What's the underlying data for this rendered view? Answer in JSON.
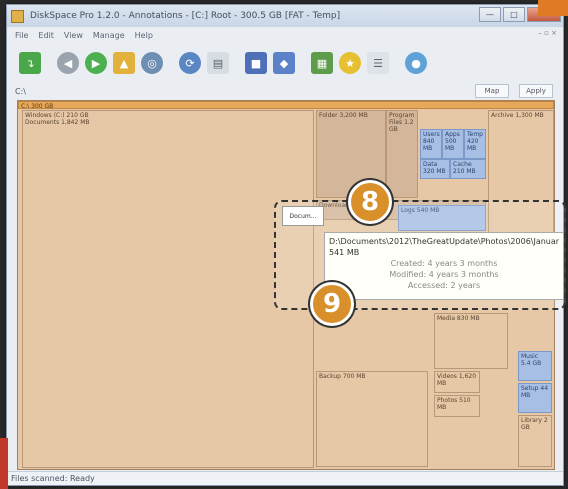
{
  "window": {
    "title": "DiskSpace Pro 1.2.0 - Annotations - [C:] Root - 300.5 GB [FAT - Temp]",
    "min": "—",
    "max": "□",
    "close": "✕"
  },
  "menu": [
    "File",
    "Edit",
    "View",
    "Manage",
    "Help"
  ],
  "mdi": "– ▫ ×",
  "path": {
    "text": "C:\\",
    "btn1": "Map",
    "btn2": "Apply"
  },
  "treemap": {
    "root_label": "C:\\ 300 GB",
    "items": [
      {
        "label": "Windows (C:) 210 GB\nDocuments 1,842 MB"
      },
      {
        "label": "Folder 3,200 MB"
      },
      {
        "label": "Program Files 1.2 GB"
      },
      {
        "label": "Users 840 MB"
      },
      {
        "label": "Apps 500 MB"
      },
      {
        "label": "Temp 420 MB"
      },
      {
        "label": "Data 320 MB"
      },
      {
        "label": "Cache 210 MB"
      },
      {
        "label": "Archive 1,300 MB"
      },
      {
        "label": "Downloads 640 MB"
      },
      {
        "label": "Logs 540 MB"
      },
      {
        "label": "Media 830 MB"
      },
      {
        "label": "Backup 700 MB"
      },
      {
        "label": "Videos 1,620 MB"
      },
      {
        "label": "Photos 510 MB"
      },
      {
        "label": "Music 5.4 GB"
      },
      {
        "label": "Setup 44 MB"
      },
      {
        "label": "Library 2 GB"
      }
    ]
  },
  "popbox": "Docum...",
  "tooltip": {
    "line1": "D:\\Documents\\2012\\TheGreatUpdate\\Photos\\2006\\January\\",
    "line2": "541 MB",
    "created": "Created: 4 years 3 months",
    "modified": "Modified: 4 years 3 months",
    "accessed": "Accessed: 2 years"
  },
  "badges": {
    "top": "8",
    "bottom": "9"
  },
  "status": "Files scanned: Ready",
  "colors": {
    "accent": "#d9902a",
    "treemap": "#e6c8a6",
    "highlight": "#a7bfe4"
  }
}
